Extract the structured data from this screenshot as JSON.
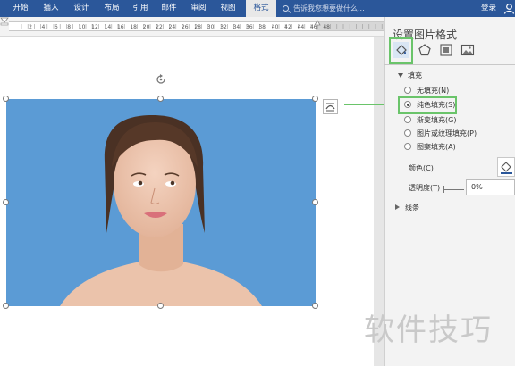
{
  "ribbon": {
    "tabs": [
      "开始",
      "插入",
      "设计",
      "布局",
      "引用",
      "邮件",
      "审阅",
      "视图",
      "格式"
    ],
    "active_tab": "格式",
    "search_placeholder": "告诉我您想要做什么...",
    "login": "登录",
    "color": "#2b579a"
  },
  "ruler": {
    "labels": [
      "2",
      "4",
      "6",
      "8",
      "10",
      "12",
      "14",
      "16",
      "18",
      "20",
      "22",
      "24",
      "26",
      "28",
      "30",
      "32",
      "34",
      "36",
      "38",
      "40",
      "42",
      "44",
      "46",
      "48"
    ]
  },
  "image": {
    "background": "#5b9bd5",
    "alt": "woman portrait"
  },
  "panel": {
    "title": "设置图片格式",
    "icons": [
      "fill-line-icon",
      "effects-pentagon-icon",
      "layout-properties-icon",
      "picture-icon"
    ],
    "section_fill": "填充",
    "fill_options": [
      {
        "label": "无填充(N)",
        "selected": false
      },
      {
        "label": "纯色填充(S)",
        "selected": true
      },
      {
        "label": "渐变填充(G)",
        "selected": false
      },
      {
        "label": "图片或纹理填充(P)",
        "selected": false
      },
      {
        "label": "图案填充(A)",
        "selected": false
      }
    ],
    "color_label": "颜色(C)",
    "transparency_label": "透明度(T)",
    "transparency_value": "0%",
    "section_line": "线条"
  },
  "highlight_color": "#6ac46a",
  "watermark": "软件技巧"
}
